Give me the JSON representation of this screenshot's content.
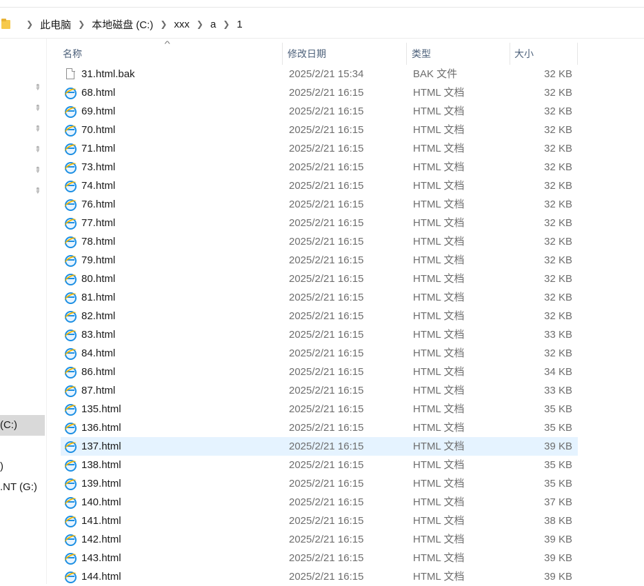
{
  "breadcrumb": {
    "folder_icon": "folder-icon",
    "items": [
      "此电脑",
      "本地磁盘 (C:)",
      "xxx",
      "a",
      "1"
    ],
    "separator_icon": "chevron-right-icon"
  },
  "nav_pane": {
    "pin_icon": "pin-icon",
    "drives": [
      "(C:)",
      ")",
      ".NT (G:)"
    ]
  },
  "columns": {
    "name": "名称",
    "date": "修改日期",
    "type": "类型",
    "size": "大小",
    "sort_icon": "sort-ascending-icon"
  },
  "files": [
    {
      "name": "31.html.bak",
      "date": "2025/2/21 15:34",
      "type": "BAK 文件",
      "size": "32 KB",
      "icon": "generic-file-icon"
    },
    {
      "name": "68.html",
      "date": "2025/2/21 16:15",
      "type": "HTML 文档",
      "size": "32 KB",
      "icon": "ie-html-icon"
    },
    {
      "name": "69.html",
      "date": "2025/2/21 16:15",
      "type": "HTML 文档",
      "size": "32 KB",
      "icon": "ie-html-icon"
    },
    {
      "name": "70.html",
      "date": "2025/2/21 16:15",
      "type": "HTML 文档",
      "size": "32 KB",
      "icon": "ie-html-icon"
    },
    {
      "name": "71.html",
      "date": "2025/2/21 16:15",
      "type": "HTML 文档",
      "size": "32 KB",
      "icon": "ie-html-icon"
    },
    {
      "name": "73.html",
      "date": "2025/2/21 16:15",
      "type": "HTML 文档",
      "size": "32 KB",
      "icon": "ie-html-icon"
    },
    {
      "name": "74.html",
      "date": "2025/2/21 16:15",
      "type": "HTML 文档",
      "size": "32 KB",
      "icon": "ie-html-icon"
    },
    {
      "name": "76.html",
      "date": "2025/2/21 16:15",
      "type": "HTML 文档",
      "size": "32 KB",
      "icon": "ie-html-icon"
    },
    {
      "name": "77.html",
      "date": "2025/2/21 16:15",
      "type": "HTML 文档",
      "size": "32 KB",
      "icon": "ie-html-icon"
    },
    {
      "name": "78.html",
      "date": "2025/2/21 16:15",
      "type": "HTML 文档",
      "size": "32 KB",
      "icon": "ie-html-icon"
    },
    {
      "name": "79.html",
      "date": "2025/2/21 16:15",
      "type": "HTML 文档",
      "size": "32 KB",
      "icon": "ie-html-icon"
    },
    {
      "name": "80.html",
      "date": "2025/2/21 16:15",
      "type": "HTML 文档",
      "size": "32 KB",
      "icon": "ie-html-icon"
    },
    {
      "name": "81.html",
      "date": "2025/2/21 16:15",
      "type": "HTML 文档",
      "size": "32 KB",
      "icon": "ie-html-icon"
    },
    {
      "name": "82.html",
      "date": "2025/2/21 16:15",
      "type": "HTML 文档",
      "size": "32 KB",
      "icon": "ie-html-icon"
    },
    {
      "name": "83.html",
      "date": "2025/2/21 16:15",
      "type": "HTML 文档",
      "size": "33 KB",
      "icon": "ie-html-icon"
    },
    {
      "name": "84.html",
      "date": "2025/2/21 16:15",
      "type": "HTML 文档",
      "size": "32 KB",
      "icon": "ie-html-icon"
    },
    {
      "name": "86.html",
      "date": "2025/2/21 16:15",
      "type": "HTML 文档",
      "size": "34 KB",
      "icon": "ie-html-icon"
    },
    {
      "name": "87.html",
      "date": "2025/2/21 16:15",
      "type": "HTML 文档",
      "size": "33 KB",
      "icon": "ie-html-icon"
    },
    {
      "name": "135.html",
      "date": "2025/2/21 16:15",
      "type": "HTML 文档",
      "size": "35 KB",
      "icon": "ie-html-icon"
    },
    {
      "name": "136.html",
      "date": "2025/2/21 16:15",
      "type": "HTML 文档",
      "size": "35 KB",
      "icon": "ie-html-icon"
    },
    {
      "name": "137.html",
      "date": "2025/2/21 16:15",
      "type": "HTML 文档",
      "size": "39 KB",
      "icon": "ie-html-icon",
      "selected": true
    },
    {
      "name": "138.html",
      "date": "2025/2/21 16:15",
      "type": "HTML 文档",
      "size": "35 KB",
      "icon": "ie-html-icon"
    },
    {
      "name": "139.html",
      "date": "2025/2/21 16:15",
      "type": "HTML 文档",
      "size": "35 KB",
      "icon": "ie-html-icon"
    },
    {
      "name": "140.html",
      "date": "2025/2/21 16:15",
      "type": "HTML 文档",
      "size": "37 KB",
      "icon": "ie-html-icon"
    },
    {
      "name": "141.html",
      "date": "2025/2/21 16:15",
      "type": "HTML 文档",
      "size": "38 KB",
      "icon": "ie-html-icon"
    },
    {
      "name": "142.html",
      "date": "2025/2/21 16:15",
      "type": "HTML 文档",
      "size": "39 KB",
      "icon": "ie-html-icon"
    },
    {
      "name": "143.html",
      "date": "2025/2/21 16:15",
      "type": "HTML 文档",
      "size": "39 KB",
      "icon": "ie-html-icon"
    },
    {
      "name": "144.html",
      "date": "2025/2/21 16:15",
      "type": "HTML 文档",
      "size": "39 KB",
      "icon": "ie-html-icon"
    }
  ],
  "colors": {
    "selected_row": "#e5f3ff",
    "nav_selected": "#d9d9d9",
    "header_text": "#4c607a"
  }
}
